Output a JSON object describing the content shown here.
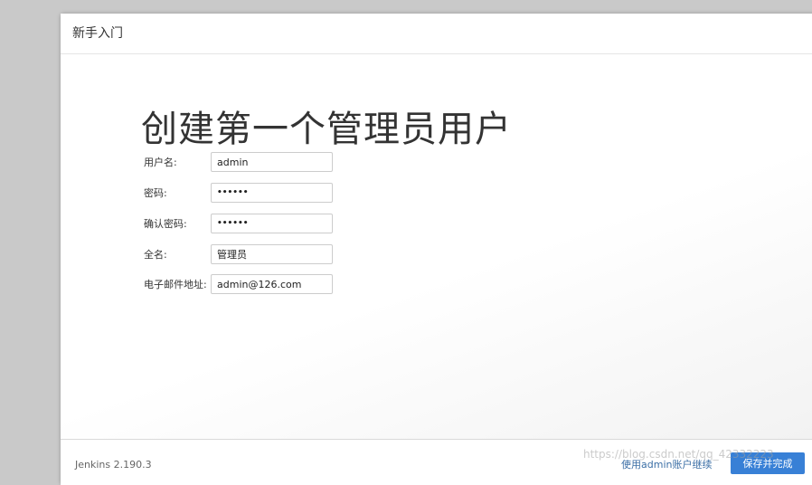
{
  "dialog": {
    "title": "新手入门"
  },
  "main": {
    "heading": "创建第一个管理员用户",
    "fields": [
      {
        "label": "用户名:",
        "value": "admin"
      },
      {
        "label": "密码:",
        "value": "••••••"
      },
      {
        "label": "确认密码:",
        "value": "••••••"
      },
      {
        "label": "全名:",
        "value": "管理员"
      },
      {
        "label": "电子邮件地址:",
        "value": "admin@126.com"
      }
    ]
  },
  "footer": {
    "version": "Jenkins 2.190.3",
    "skip_link": "使用admin账户继续",
    "save_button": "保存并完成"
  },
  "watermark": "https://blog.csdn.net/qq_42332223",
  "colors": {
    "primary_button": "#3880d6",
    "link": "#3a6ea5",
    "backdrop": "#c9c9c9"
  }
}
